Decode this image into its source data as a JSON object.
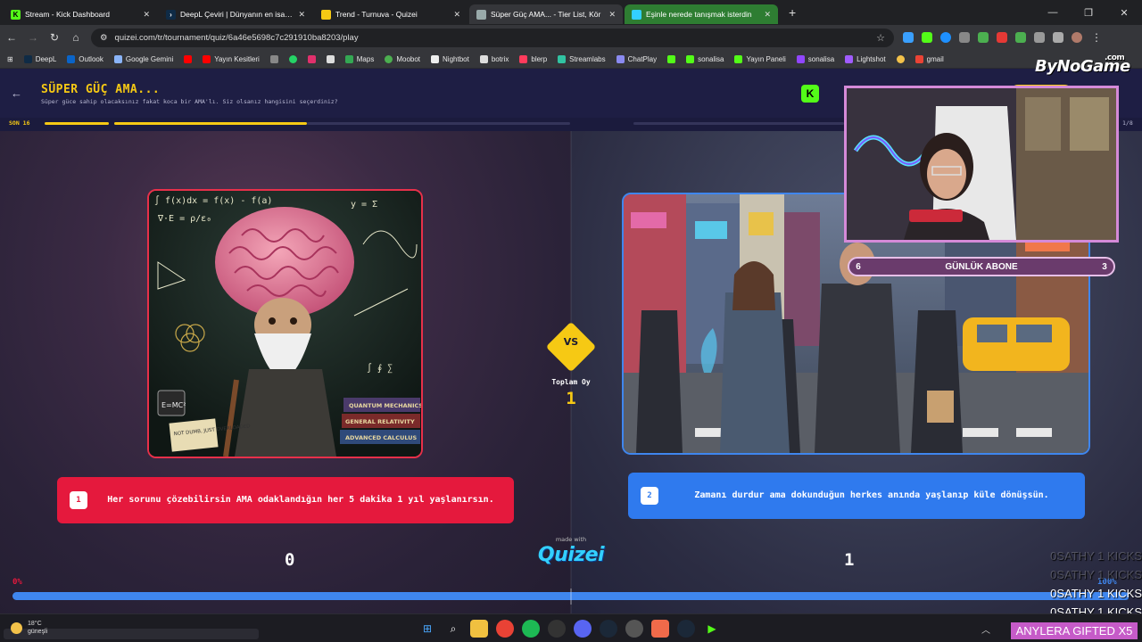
{
  "browser": {
    "tabs": [
      {
        "label": "Stream - Kick Dashboard",
        "color": "#53fc18"
      },
      {
        "label": "DeepL Çeviri | Dünyanın en isabet",
        "color": "#0f2b46"
      },
      {
        "label": "Trend - Turnuva - Quizei",
        "color": "#f6c914"
      },
      {
        "label": "Süper Güç AMA... - Tier List, Kör",
        "color": "#9aa"
      },
      {
        "label": "Eşinle nerede tanışmak isterdin",
        "color": "#33d0ff"
      }
    ],
    "new_tab": "+",
    "url": "quizei.com/tr/tournament/quiz/6a46e5698c7c291910ba8203/play",
    "bookmarks": [
      {
        "label": "DeepL",
        "color": "#0f2b46"
      },
      {
        "label": "Outlook",
        "color": "#0a64c8"
      },
      {
        "label": "Google Gemini",
        "color": "#8ab4f8"
      },
      {
        "label": "",
        "color": "#ff0000"
      },
      {
        "label": "Yayın Kesitleri",
        "color": "#ff0000"
      },
      {
        "label": "",
        "color": "#888888"
      },
      {
        "label": "",
        "color": "#25d366"
      },
      {
        "label": "",
        "color": "#e1306c"
      },
      {
        "label": "",
        "color": "#dddddd"
      },
      {
        "label": "Maps",
        "color": "#34a853"
      },
      {
        "label": "Moobot",
        "color": "#4caf50"
      },
      {
        "label": "Nightbot",
        "color": "#eeeeee"
      },
      {
        "label": "botrix",
        "color": "#dddddd"
      },
      {
        "label": "blerp",
        "color": "#ff3b5c"
      },
      {
        "label": "Streamlabs",
        "color": "#31c3a2"
      },
      {
        "label": "ChatPlay",
        "color": "#8a8af0"
      },
      {
        "label": "",
        "color": "#53fc18"
      },
      {
        "label": "sonalisa",
        "color": "#53fc18"
      },
      {
        "label": "Yayın Paneli",
        "color": "#53fc18"
      },
      {
        "label": "sonalisa",
        "color": "#9146ff"
      },
      {
        "label": "Lightshot",
        "color": "#a05cff"
      },
      {
        "label": "",
        "color": "#f3c24a"
      },
      {
        "label": "gmail",
        "color": "#ea4335"
      }
    ]
  },
  "quiz": {
    "title": "SÜPER GÜÇ AMA...",
    "subtitle": "Süper güce sahip olacaksınız fakat koca bir AMA'lı. Siz olsanız hangisini seçerdiniz?",
    "round": "SON 16",
    "progress_count": "1/8",
    "vs": "VS",
    "total_label": "Toplam Oy",
    "total_votes": "1",
    "made_with": "made with",
    "logo": "Quizei",
    "left": {
      "number": "1",
      "text": "Her sorunu çözebilirsin AMA odaklandığın her 5 dakika 1 yıl yaşlanırsın.",
      "votes": "0",
      "percent": "0%",
      "color": "#e5193d"
    },
    "right": {
      "number": "2",
      "text": "Zamanı durdur ama dokunduğun herkes anında yaşlanıp küle dönüşsün.",
      "votes": "1",
      "percent": "100%",
      "color": "#2f7aee"
    },
    "result_fraction_right": 1.0
  },
  "images": {
    "left_board_text": [
      "∫ f(x)dx = f(x) - f(a)",
      "∇·E = ρ/ε₀",
      "y = Σ",
      "E = mc²",
      "QUANTUM MECHANICS",
      "GENERAL RELATIVITY",
      "ADVANCED CALCULUS",
      "NOT DUMB, JUST OVERLOADED",
      "E=MC²"
    ]
  },
  "stream": {
    "brand": "ByNoGame",
    "brand_suffix": ".com",
    "sub_left": "6",
    "sub_label": "GÜNLÜK ABONE",
    "sub_right": "3",
    "feed": [
      "0SATHY 1 KICKS",
      "0SATHY 1 KICKS",
      "0SATHY 1 KICKS",
      "0SATHY 1 KICKS"
    ],
    "gift": "ANYLERA GIFTED X5"
  },
  "taskbar": {
    "temperature": "18°C",
    "weather": "güneşli"
  }
}
